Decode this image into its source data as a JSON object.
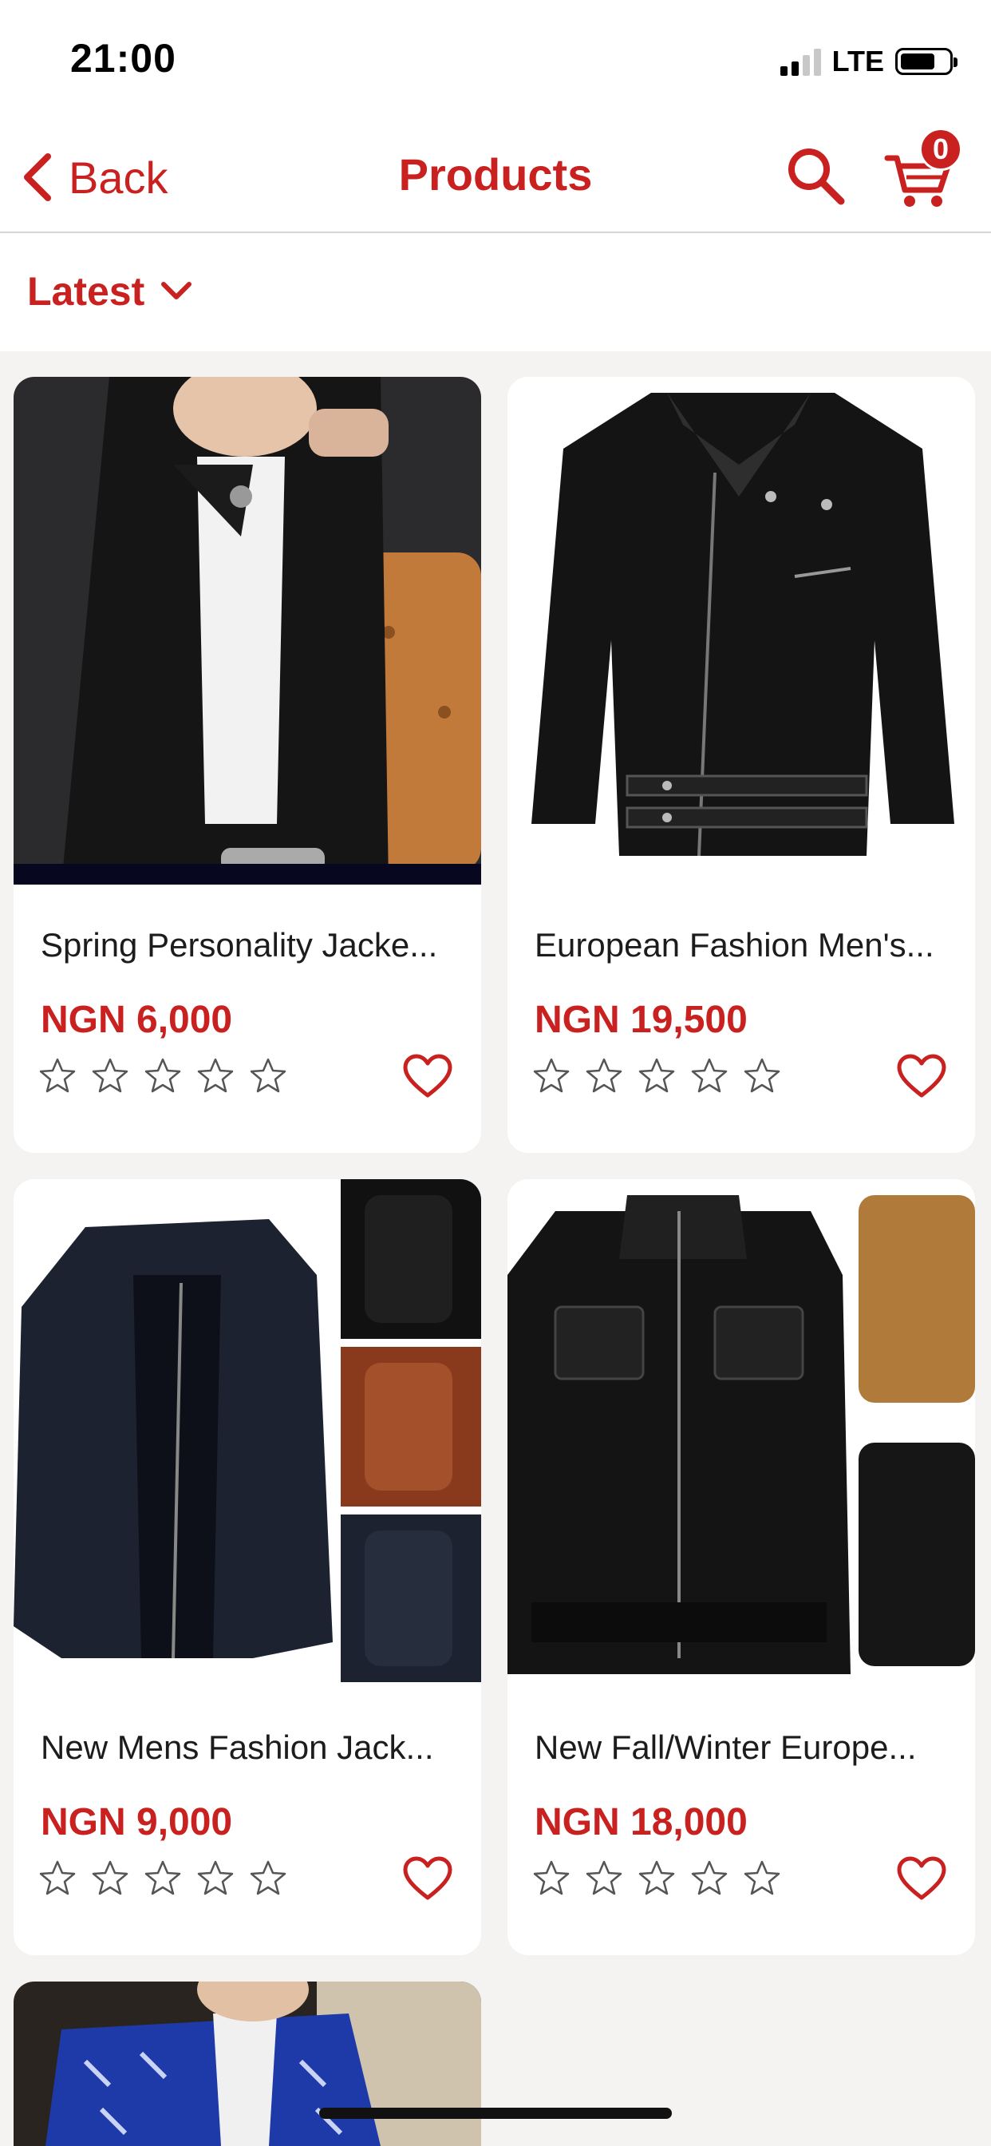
{
  "status_bar": {
    "time": "21:00",
    "network": "LTE"
  },
  "nav": {
    "back_label": "Back",
    "title": "Products",
    "cart_count": "0"
  },
  "sort": {
    "selected": "Latest"
  },
  "products": [
    {
      "name": "Spring Personality Jacke...",
      "price": "NGN 6,000",
      "rating": 0,
      "favorite": false
    },
    {
      "name": "European Fashion Men's...",
      "price": "NGN 19,500",
      "rating": 0,
      "favorite": false
    },
    {
      "name": "New Mens Fashion Jack...",
      "price": "NGN 9,000",
      "rating": 0,
      "favorite": false
    },
    {
      "name": "New Fall/Winter Europe...",
      "price": "NGN 18,000",
      "rating": 0,
      "favorite": false
    }
  ],
  "colors": {
    "accent": "#c8211f",
    "background": "#f4f3f2",
    "card": "#ffffff"
  },
  "icons": [
    "chevron-left-icon",
    "search-icon",
    "cart-icon",
    "chevron-down-icon",
    "star-outline-icon",
    "heart-outline-icon"
  ]
}
